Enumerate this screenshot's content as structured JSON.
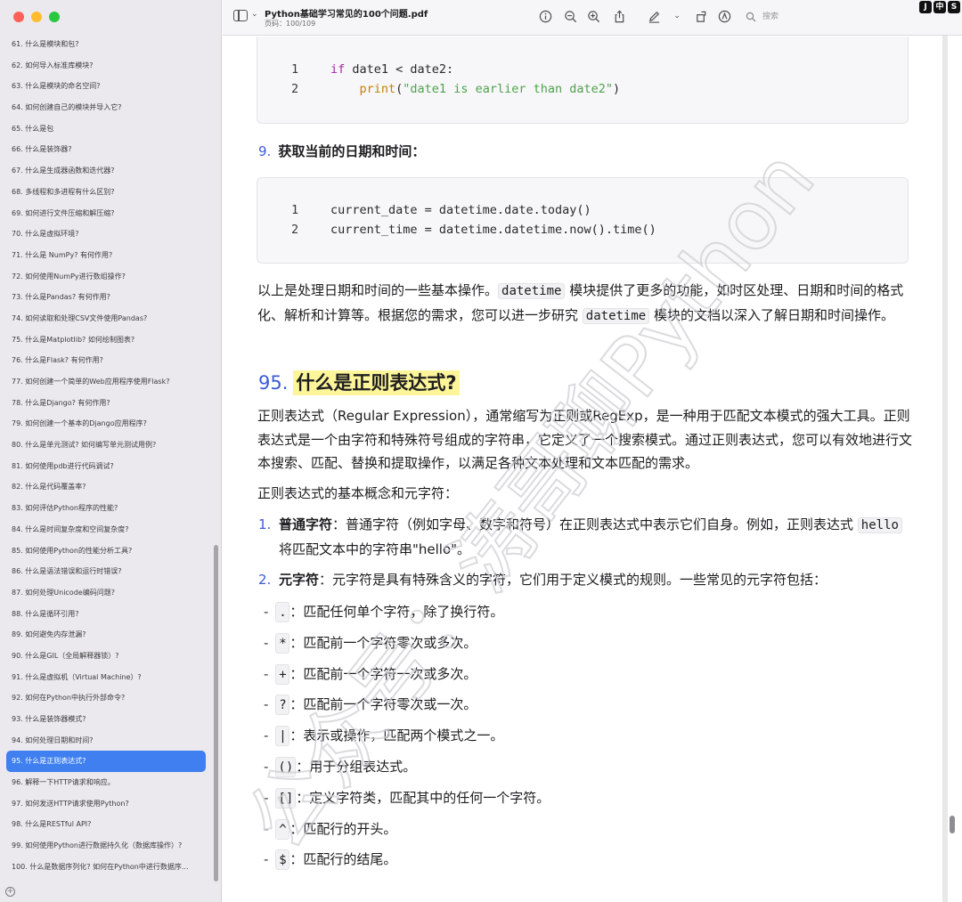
{
  "window": {
    "doc_title": "Python基础学习常见的100个问题.pdf",
    "page_indicator": "页码：100/109",
    "search_placeholder": "搜索",
    "badges": [
      "J",
      "中",
      "S"
    ]
  },
  "sidebar": {
    "items": [
      {
        "label": "61. 什么是模块和包?"
      },
      {
        "label": "62. 如何导入标准库模块?"
      },
      {
        "label": "63. 什么是模块的命名空间?"
      },
      {
        "label": "64. 如何创建自己的模块并导入它?"
      },
      {
        "label": "65. 什么是包"
      },
      {
        "label": "66. 什么是装饰器?"
      },
      {
        "label": "67. 什么是生成器函数和迭代器?"
      },
      {
        "label": "68. 多线程和多进程有什么区别?"
      },
      {
        "label": "69. 如何进行文件压缩和解压缩?"
      },
      {
        "label": "70. 什么是虚拟环境?"
      },
      {
        "label": "71. 什么是 NumPy? 有何作用?"
      },
      {
        "label": "72. 如何使用NumPy进行数组操作?"
      },
      {
        "label": "73. 什么是Pandas? 有何作用?"
      },
      {
        "label": "74. 如何读取和处理CSV文件使用Pandas?"
      },
      {
        "label": "75. 什么是Matplotlib? 如何绘制图表?"
      },
      {
        "label": "76. 什么是Flask? 有何作用?"
      },
      {
        "label": "77. 如何创建一个简单的Web应用程序使用Flask?"
      },
      {
        "label": "78. 什么是Django? 有何作用?"
      },
      {
        "label": "79. 如何创建一个基本的Django应用程序?"
      },
      {
        "label": "80. 什么是单元测试? 如何编写单元测试用例?"
      },
      {
        "label": "81. 如何使用pdb进行代码调试?"
      },
      {
        "label": "82. 什么是代码覆盖率?"
      },
      {
        "label": "83. 如何评估Python程序的性能?"
      },
      {
        "label": "84. 什么是时间复杂度和空间复杂度?"
      },
      {
        "label": "85. 如何使用Python的性能分析工具?"
      },
      {
        "label": "86. 什么是语法错误和运行时错误?"
      },
      {
        "label": "87. 如何处理Unicode编码问题?"
      },
      {
        "label": "88. 什么是循环引用?"
      },
      {
        "label": "89. 如何避免内存泄漏?"
      },
      {
        "label": "90. 什么是GIL（全局解释器锁）?"
      },
      {
        "label": "91. 什么是虚拟机（Virtual Machine）?"
      },
      {
        "label": "92. 如何在Python中执行外部命令?"
      },
      {
        "label": "93. 什么是装饰器模式?"
      },
      {
        "label": "94. 如何处理日期和时间?"
      },
      {
        "label": "95. 什么是正则表达式?"
      },
      {
        "label": "96. 解释一下HTTP请求和响应。"
      },
      {
        "label": "97. 如何发送HTTP请求使用Python?"
      },
      {
        "label": "98. 什么是RESTful API?"
      },
      {
        "label": "99. 如何使用Python进行数据持久化（数据库操作）?"
      },
      {
        "label": "100. 什么是数据序列化? 如何在Python中进行数据序..."
      }
    ],
    "active_index": 34
  },
  "content": {
    "code1": [
      {
        "n": "1",
        "tokens": [
          [
            "kw",
            "if"
          ],
          [
            "",
            " date1 < date2:"
          ]
        ]
      },
      {
        "n": "2",
        "tokens": [
          [
            "",
            "    "
          ],
          [
            "fn",
            "print"
          ],
          [
            "",
            "("
          ],
          [
            "str",
            "\"date1 is earlier than date2\""
          ],
          [
            "",
            ")"
          ]
        ]
      }
    ],
    "item9_num": "9.",
    "item9_title": "获取当前的日期和时间：",
    "code2": [
      {
        "n": "1",
        "tokens": [
          [
            "",
            "current_date = datetime.date.today()"
          ]
        ]
      },
      {
        "n": "2",
        "tokens": [
          [
            "",
            "current_time = datetime.datetime.now().time()"
          ]
        ]
      }
    ],
    "para1": {
      "a": "以上是处理日期和时间的一些基本操作。",
      "code1": "datetime",
      "b": " 模块提供了更多的功能，如时区处理、日期和时间的格式化、解析和计算等。根据您的需求，您可以进一步研究 ",
      "code2": "datetime",
      "c": " 模块的文档以深入了解日期和时间操作。"
    },
    "h2_num": "95.",
    "h2_text": "什么是正则表达式?",
    "para2": "正则表达式（Regular Expression），通常缩写为正则或RegExp，是一种用于匹配文本模式的强大工具。正则表达式是一个由字符和特殊符号组成的字符串，它定义了一个搜索模式。通过正则表达式，您可以有效地进行文本搜索、匹配、替换和提取操作，以满足各种文本处理和文本匹配的需求。",
    "para3": "正则表达式的基本概念和元字符：",
    "ol1": {
      "n": "1.",
      "bold": "普通字符",
      "a": "：普通字符（例如字母、数字和符号）在正则表达式中表示它们自身。例如，正则表达式 ",
      "code": "hello",
      "b": " 将匹配文本中的字符串\"hello\"。"
    },
    "ol2": {
      "n": "2.",
      "bold": "元字符",
      "a": "：元字符是具有特殊含义的字符，它们用于定义模式的规则。一些常见的元字符包括："
    },
    "bullets": [
      {
        "chip": ".",
        "text": "：匹配任何单个字符，除了换行符。"
      },
      {
        "chip": "*",
        "text": "：匹配前一个字符零次或多次。"
      },
      {
        "chip": "+",
        "text": "：匹配前一个字符一次或多次。"
      },
      {
        "chip": "?",
        "text": "：匹配前一个字符零次或一次。"
      },
      {
        "chip": "|",
        "text": "：表示或操作，匹配两个模式之一。"
      },
      {
        "chip": "()",
        "text": "：用于分组表达式。"
      },
      {
        "chip": "[]",
        "text": "：定义字符类，匹配其中的任何一个字符。"
      },
      {
        "chip": "^",
        "text": "：匹配行的开头。"
      },
      {
        "chip": "$",
        "text": "：匹配行的结尾。"
      }
    ],
    "bullet_dash": "-"
  },
  "watermark": "公众号：涛哥聊Python",
  "colors": {
    "accent": "#3f7ff0",
    "heading_num": "#3c5bd8",
    "highlight": "#fdf59a"
  }
}
